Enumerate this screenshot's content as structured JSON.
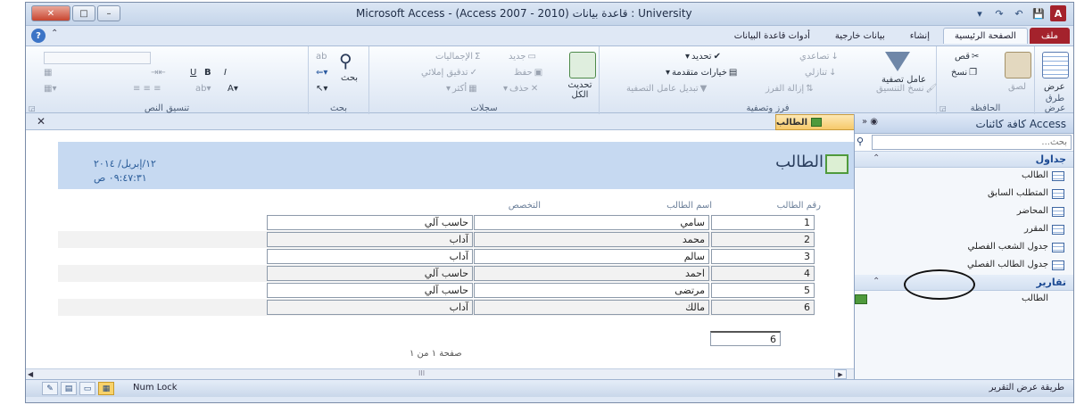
{
  "window": {
    "title": "Microsoft Access - (Access 2007 - 2010) قاعدة بيانات : University",
    "controls": {
      "close": "✕",
      "maximize": "□",
      "minimize": "–"
    },
    "qat": {
      "app": "A",
      "save": "💾",
      "undo": "↶",
      "redo": "↷",
      "customize": "▾"
    }
  },
  "ribbon_tabs": [
    "ملف",
    "الصفحة الرئيسية",
    "إنشاء",
    "بيانات خارجية",
    "أدوات قاعدة البيانات"
  ],
  "ribbon": {
    "views": {
      "view": "عرض",
      "group": "طرق عرض"
    },
    "clipboard": {
      "paste": "لصق",
      "cut": "قص",
      "copy": "نسخ",
      "format_painter": "نسخ التنسيق",
      "group": "الحافظة"
    },
    "sort_filter": {
      "filter": "عامل تصفية",
      "ascending": "تصاعدي",
      "descending": "تنازلي",
      "remove_sort": "إزالة الفرز",
      "selection": "تحديد",
      "advanced": "خيارات متقدمة",
      "toggle_filter": "تبديل عامل التصفية",
      "group": "فرز وتصفية"
    },
    "records": {
      "refresh": "تحديث الكل",
      "new": "جديد",
      "save": "حفظ",
      "delete": "حذف",
      "totals": "الإجماليات",
      "spelling": "تدقيق إملائي",
      "more": "أكثر",
      "group": "سجلات"
    },
    "find": {
      "find": "بحث",
      "group": "بحث"
    },
    "text_formatting": {
      "bold": "B",
      "italic": "I",
      "underline": "U",
      "group": "تنسيق النص"
    }
  },
  "nav_pane": {
    "title": "كافة كائنات Access",
    "search_placeholder": "بحث...",
    "tables_header": "جداول",
    "tables": [
      "الطالب",
      "المتطلب السابق",
      "المحاضر",
      "المقرر",
      "جدول الشعب الفصلي",
      "جدول الطالب الفصلي"
    ],
    "reports_header": "تقارير",
    "reports": [
      "الطالب"
    ]
  },
  "document_tab": {
    "label": "الطالب"
  },
  "report": {
    "title": "الطالب",
    "date": "١٢/إبريل/ ٢٠١٤",
    "time": "٠٩:٤٧:٣١ ص",
    "columns": [
      "رقم الطالب",
      "اسم الطالب",
      "التخصص"
    ],
    "rows": [
      {
        "id": "1",
        "name": "سامي",
        "major": "حاسب آلي"
      },
      {
        "id": "2",
        "name": "محمد",
        "major": "آداب"
      },
      {
        "id": "3",
        "name": "سالم",
        "major": "آداب"
      },
      {
        "id": "4",
        "name": "احمد",
        "major": "حاسب آلي"
      },
      {
        "id": "5",
        "name": "مرتضى",
        "major": "حاسب آلي"
      },
      {
        "id": "6",
        "name": "مالك",
        "major": "آداب"
      }
    ],
    "total": "6",
    "page_label": "صفحة ١ من ١"
  },
  "status_bar": {
    "left": "طريقة عرض التقرير",
    "numlock": "Num Lock"
  }
}
